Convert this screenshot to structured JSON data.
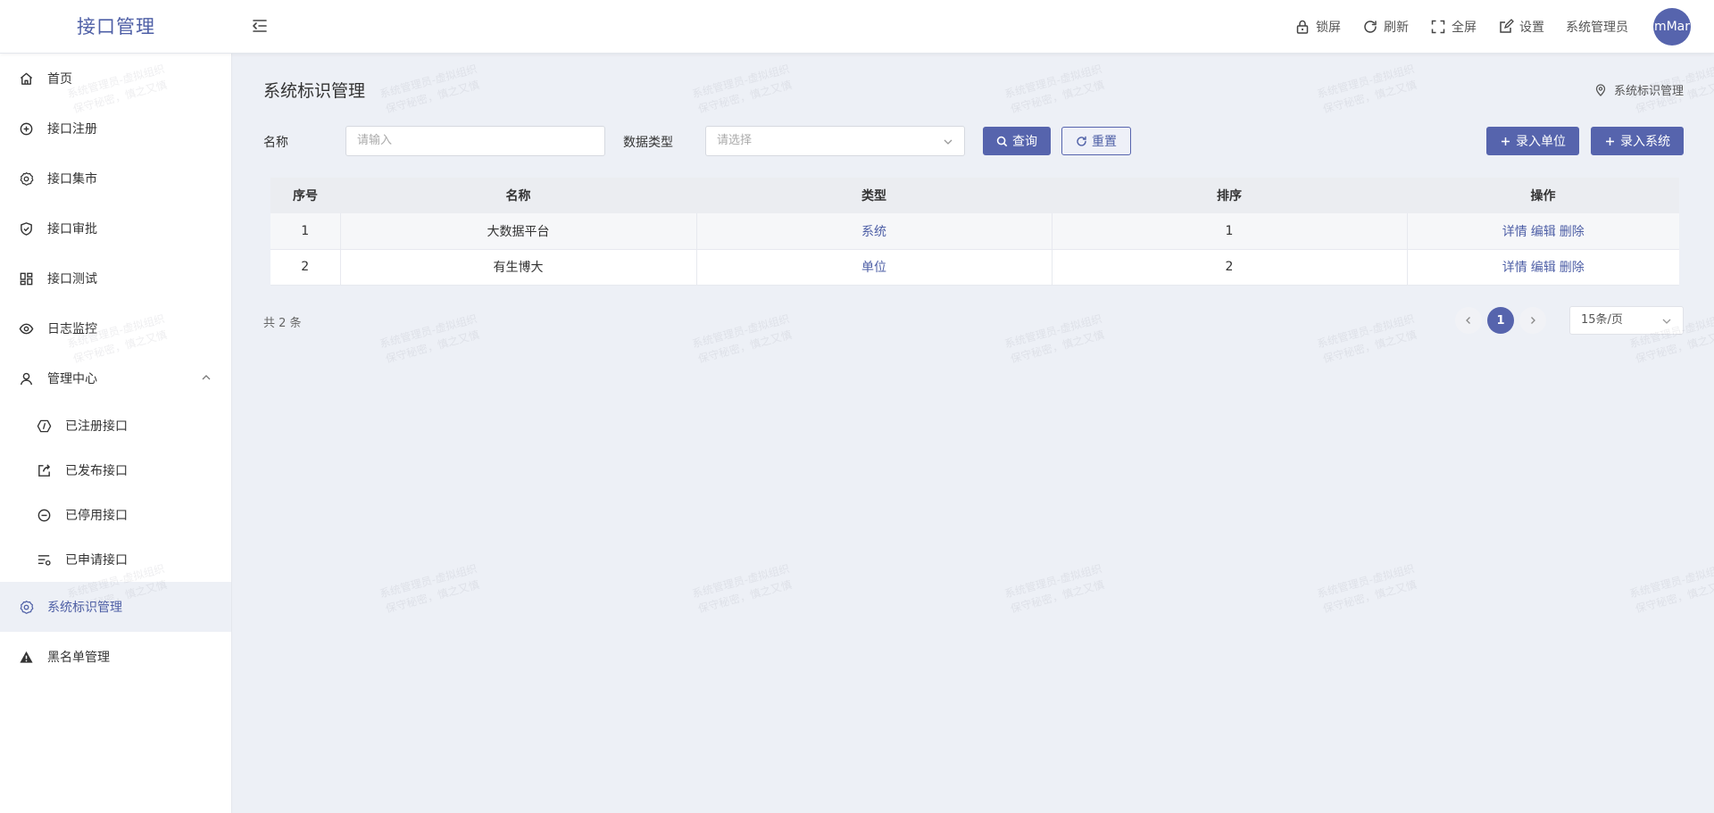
{
  "app": {
    "title": "接口管理"
  },
  "header": {
    "lock": "锁屏",
    "refresh": "刷新",
    "fullscreen": "全屏",
    "settings": "设置",
    "username": "系统管理员",
    "avatar_text": "mMar"
  },
  "sidebar": {
    "items": [
      {
        "label": "首页",
        "icon": "home-icon"
      },
      {
        "label": "接口注册",
        "icon": "plus-circle-icon"
      },
      {
        "label": "接口集市",
        "icon": "gear-icon"
      },
      {
        "label": "接口审批",
        "icon": "shield-check-icon"
      },
      {
        "label": "接口测试",
        "icon": "dashboard-grid-icon"
      },
      {
        "label": "日志监控",
        "icon": "eye-icon"
      },
      {
        "label": "管理中心",
        "icon": "user-icon",
        "expanded": true
      }
    ],
    "sub_items": [
      {
        "label": "已注册接口",
        "icon": "api-icon"
      },
      {
        "label": "已发布接口",
        "icon": "share-out-icon"
      },
      {
        "label": "已停用接口",
        "icon": "minus-circle-icon"
      },
      {
        "label": "已申请接口",
        "icon": "list-gear-icon"
      }
    ],
    "bottom_items": [
      {
        "label": "系统标识管理",
        "icon": "gear-icon",
        "active": true
      },
      {
        "label": "黑名单管理",
        "icon": "warning-icon"
      }
    ]
  },
  "page": {
    "title": "系统标识管理",
    "breadcrumb": "系统标识管理"
  },
  "filter": {
    "name_label": "名称",
    "name_placeholder": "请输入",
    "type_label": "数据类型",
    "type_placeholder": "请选择",
    "search_btn": "查询",
    "reset_btn": "重置",
    "add_unit_btn": "录入单位",
    "add_system_btn": "录入系统"
  },
  "table": {
    "headers": [
      "序号",
      "名称",
      "类型",
      "排序",
      "操作"
    ],
    "rows": [
      {
        "index": "1",
        "name": "大数据平台",
        "type": "系统",
        "sort": "1",
        "ops": [
          "详情",
          "编辑",
          "删除"
        ]
      },
      {
        "index": "2",
        "name": "有生博大",
        "type": "单位",
        "sort": "2",
        "ops": [
          "详情",
          "编辑",
          "删除"
        ]
      }
    ]
  },
  "pagination": {
    "total": "共 2 条",
    "current_page": "1",
    "page_size": "15条/页"
  },
  "watermark": {
    "line1": "系统管理员-虚拟组织",
    "line2": "保守秘密，慎之又慎"
  },
  "colors": {
    "accent": "#5664ad",
    "background": "#edf0f6",
    "logo_text": "#4e5fa6"
  }
}
